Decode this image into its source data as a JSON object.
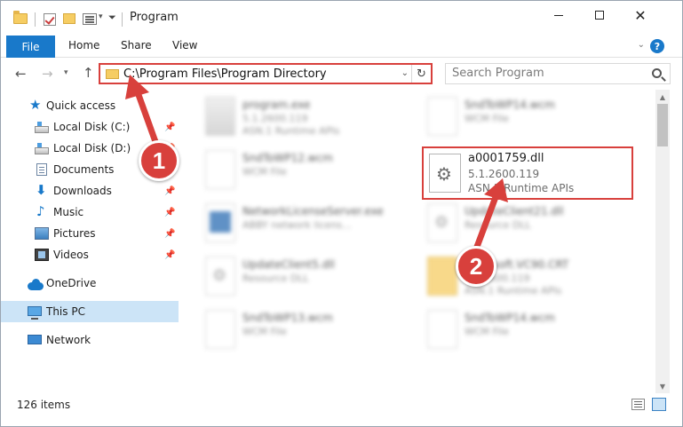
{
  "window": {
    "title": "Program"
  },
  "ribbon": {
    "tabs": [
      "File",
      "Home",
      "Share",
      "View"
    ]
  },
  "address": {
    "path": "C:\\Program Files\\Program Directory",
    "search_placeholder": "Search Program"
  },
  "sidebar": {
    "items": [
      {
        "label": "Quick access",
        "icon": "star-icon",
        "pinned": false
      },
      {
        "label": "Local Disk (C:)",
        "icon": "disk-icon",
        "pinned": true
      },
      {
        "label": "Local Disk (D:)",
        "icon": "disk-icon",
        "pinned": true
      },
      {
        "label": "Documents",
        "icon": "documents-icon",
        "pinned": true
      },
      {
        "label": "Downloads",
        "icon": "downloads-icon",
        "pinned": true
      },
      {
        "label": "Music",
        "icon": "music-icon",
        "pinned": true
      },
      {
        "label": "Pictures",
        "icon": "pictures-icon",
        "pinned": true
      },
      {
        "label": "Videos",
        "icon": "videos-icon",
        "pinned": true
      },
      {
        "label": "OneDrive",
        "icon": "onedrive-icon",
        "pinned": false
      },
      {
        "label": "This PC",
        "icon": "pc-icon",
        "pinned": false,
        "selected": true
      },
      {
        "label": "Network",
        "icon": "network-icon",
        "pinned": false
      }
    ]
  },
  "files": [
    {
      "name": "program.exe",
      "line1": "5.1.2600.119",
      "line2": "ASN.1 Runtime APIs",
      "type": "exe"
    },
    {
      "name": "SndToWP14.wcm",
      "line1": "WCM File",
      "line2": "",
      "type": "file"
    },
    {
      "name": "SndToWP12.wcm",
      "line1": "WCM File",
      "line2": "",
      "type": "file"
    },
    {
      "name": "NetworkLicenseServer.exe",
      "line1": "ABBY network licens...",
      "line2": "",
      "type": "net"
    },
    {
      "name": "UpdateClient21.dll",
      "line1": "Resource DLL",
      "line2": "",
      "type": "dll"
    },
    {
      "name": "UpdateClient5.dll",
      "line1": "Resource DLL",
      "line2": "",
      "type": "dll"
    },
    {
      "name": "Microsoft.VC90.CRT",
      "line1": "5.1.2600.119",
      "line2": "ASN.1 Runtime APIs",
      "type": "folder"
    },
    {
      "name": "SndToWP13.wcm",
      "line1": "WCM File",
      "line2": "",
      "type": "file"
    },
    {
      "name": "SndToWP14.wcm",
      "line1": "WCM File",
      "line2": "",
      "type": "file"
    }
  ],
  "highlighted_file": {
    "name": "a0001759.dll",
    "version": "5.1.2600.119",
    "description": "ASN.1 Runtime APIs"
  },
  "status": {
    "items_count": "126 items"
  },
  "annotations": {
    "step1": "1",
    "step2": "2"
  },
  "colors": {
    "accent": "#1979ca",
    "highlight_red": "#d8403c",
    "selected_bg": "#cce4f7"
  }
}
